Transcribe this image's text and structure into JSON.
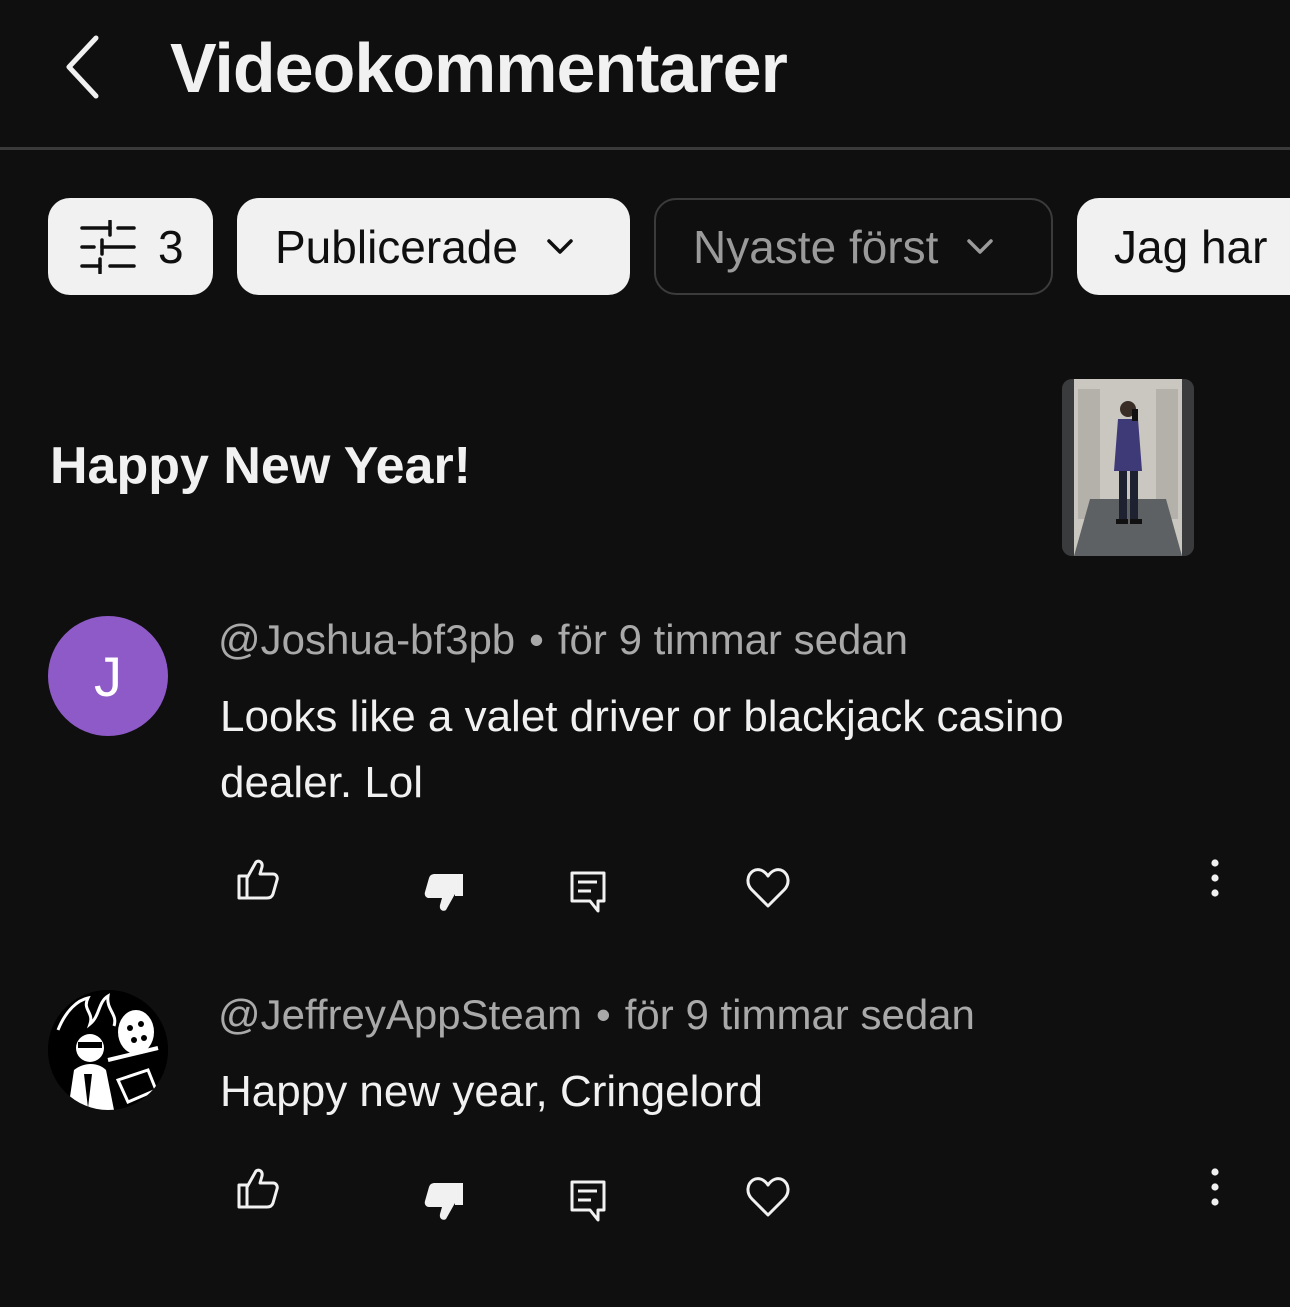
{
  "header": {
    "title": "Videokommentarer"
  },
  "filters": {
    "filter_count": "3",
    "published_label": "Publicerade",
    "sort_label": "Nyaste först",
    "partial_chip_label": "Jag har"
  },
  "video": {
    "title": "Happy New Year!"
  },
  "comments": [
    {
      "avatar_letter": "J",
      "handle": "@Joshua-bf3pb",
      "separator": "•",
      "time": "för 9 timmar sedan",
      "text": "Looks like a valet driver or blackjack casino dealer.  Lol"
    },
    {
      "handle": "@JeffreyAppSteam",
      "separator": "•",
      "time": "för 9 timmar sedan",
      "text": "Happy new year, Cringelord"
    }
  ],
  "icons": {
    "back": "chevron-left-icon",
    "filter": "sliders-icon",
    "dropdown": "chevron-down-icon",
    "like": "thumbs-up-icon",
    "dislike": "thumbs-down-icon",
    "reply": "reply-icon",
    "heart": "heart-icon",
    "more": "more-vertical-icon"
  },
  "colors": {
    "background": "#0f0f0f",
    "chip_light": "#f1f1f1",
    "avatar_purple": "#8e5ac8",
    "meta_text": "#a9a9a9"
  }
}
